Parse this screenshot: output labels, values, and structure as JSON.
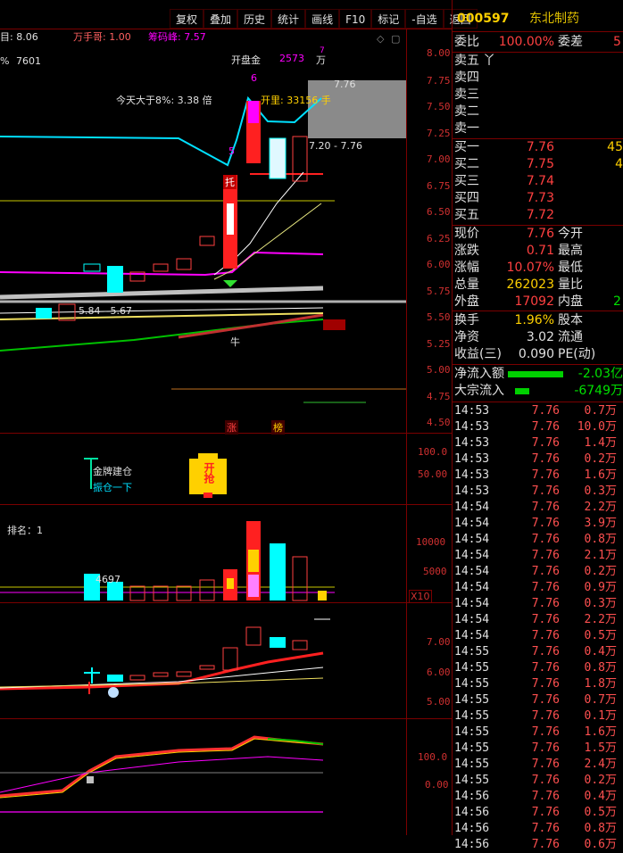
{
  "toolbar": {
    "buttons": [
      "复权",
      "叠加",
      "历史",
      "统计",
      "画线",
      "F10",
      "标记",
      "-自选",
      "返回"
    ],
    "expand_icon": "◇",
    "layout_icon": "▢"
  },
  "header": {
    "left_value_label": "目: 8.06",
    "wanshouge": "万手哥: 1.00",
    "chouma": "筹码峰: 7.57",
    "pct_label": "%",
    "pct_value": "7601"
  },
  "chart_annotations": {
    "kaipanjin_label": "开盘金",
    "kaipanjin_value": "2573",
    "kaipanjin_unit": "万",
    "kaipanjin_count": "6",
    "kaipanjin_top": "7",
    "kaili_label": "开里: 33156 手",
    "today_gt8": "今天大于8%: 3.38 倍",
    "range_label": "7.20 - 7.76",
    "price_top": "7.76",
    "five_marker": "5",
    "tuo_marker": "托",
    "ma_label": "5.84 - 5.67",
    "niu_marker": "牛",
    "zhang": "涨",
    "bang": "榜",
    "jinpai": "金牌建仓",
    "xichou": "振仓一下",
    "paiming": "排名：1",
    "vol_label": "4697",
    "kaiqiang": "开抢",
    "x10": "X10"
  },
  "axes": {
    "main": [
      "8.00",
      "7.75",
      "7.50",
      "7.25",
      "7.00",
      "6.75",
      "6.50",
      "6.25",
      "6.00",
      "5.75",
      "5.50",
      "5.25",
      "5.00",
      "4.75",
      "4.50"
    ],
    "sub1": [
      "100.0",
      "50.00"
    ],
    "sub2": [
      "10000",
      "5000"
    ],
    "sub3": [
      "7.00",
      "6.00",
      "5.00"
    ],
    "sub4": [
      "100.0",
      "0.00"
    ]
  },
  "stock": {
    "code": "000597",
    "name": "东北制药"
  },
  "quote": {
    "weibi_label": "委比",
    "weibi_value": "100.00%",
    "weicha_label": "委差",
    "weicha_value": "5",
    "sell": [
      {
        "label": "卖五",
        "price": "丫",
        "vol": ""
      },
      {
        "label": "卖四",
        "price": "",
        "vol": ""
      },
      {
        "label": "卖三",
        "price": "",
        "vol": ""
      },
      {
        "label": "卖二",
        "price": "",
        "vol": ""
      },
      {
        "label": "卖一",
        "price": "",
        "vol": ""
      }
    ],
    "buy": [
      {
        "label": "买一",
        "price": "7.76",
        "vol": "45"
      },
      {
        "label": "买二",
        "price": "7.75",
        "vol": "4"
      },
      {
        "label": "买三",
        "price": "7.74",
        "vol": ""
      },
      {
        "label": "买四",
        "price": "7.73",
        "vol": ""
      },
      {
        "label": "买五",
        "price": "7.72",
        "vol": ""
      }
    ],
    "stats": [
      {
        "l1": "现价",
        "v1": "7.76",
        "c1": "red",
        "l2": "今开",
        "v2": ""
      },
      {
        "l1": "涨跌",
        "v1": "0.71",
        "c1": "red",
        "l2": "最高",
        "v2": ""
      },
      {
        "l1": "涨幅",
        "v1": "10.07%",
        "c1": "red",
        "l2": "最低",
        "v2": ""
      },
      {
        "l1": "总量",
        "v1": "262023",
        "c1": "yel",
        "l2": "量比",
        "v2": ""
      },
      {
        "l1": "外盘",
        "v1": "17092",
        "c1": "red",
        "l2": "内盘",
        "v2": "2"
      }
    ],
    "stats2": [
      {
        "l1": "换手",
        "v1": "1.96%",
        "l2": "股本"
      },
      {
        "l1": "净资",
        "v1": "3.02",
        "l2": "流通"
      },
      {
        "l1": "收益(三)",
        "v1": "0.090",
        "l2": "PE(动)"
      }
    ],
    "flow": [
      {
        "label": "净流入额",
        "value": "-2.03亿"
      },
      {
        "label": "大宗流入",
        "value": "-6749万"
      }
    ]
  },
  "ticks": [
    [
      "14:53",
      "7.76",
      "0.7万"
    ],
    [
      "14:53",
      "7.76",
      "10.0万"
    ],
    [
      "14:53",
      "7.76",
      "1.4万"
    ],
    [
      "14:53",
      "7.76",
      "0.2万"
    ],
    [
      "14:53",
      "7.76",
      "1.6万"
    ],
    [
      "14:53",
      "7.76",
      "0.3万"
    ],
    [
      "14:54",
      "7.76",
      "2.2万"
    ],
    [
      "14:54",
      "7.76",
      "3.9万"
    ],
    [
      "14:54",
      "7.76",
      "0.8万"
    ],
    [
      "14:54",
      "7.76",
      "2.1万"
    ],
    [
      "14:54",
      "7.76",
      "0.2万"
    ],
    [
      "14:54",
      "7.76",
      "0.9万"
    ],
    [
      "14:54",
      "7.76",
      "0.3万"
    ],
    [
      "14:54",
      "7.76",
      "2.2万"
    ],
    [
      "14:54",
      "7.76",
      "0.5万"
    ],
    [
      "14:55",
      "7.76",
      "0.4万"
    ],
    [
      "14:55",
      "7.76",
      "0.8万"
    ],
    [
      "14:55",
      "7.76",
      "1.8万"
    ],
    [
      "14:55",
      "7.76",
      "0.7万"
    ],
    [
      "14:55",
      "7.76",
      "0.1万"
    ],
    [
      "14:55",
      "7.76",
      "1.6万"
    ],
    [
      "14:55",
      "7.76",
      "1.5万"
    ],
    [
      "14:55",
      "7.76",
      "2.4万"
    ],
    [
      "14:55",
      "7.76",
      "0.2万"
    ],
    [
      "14:56",
      "7.76",
      "0.4万"
    ],
    [
      "14:56",
      "7.76",
      "0.5万"
    ],
    [
      "14:56",
      "7.76",
      "0.8万"
    ],
    [
      "14:56",
      "7.76",
      "0.6万"
    ]
  ],
  "colors": {
    "up": "#ff3030",
    "down": "#00ffff",
    "accent": "#ff00ff",
    "volume_yellow": "#ffd000"
  }
}
